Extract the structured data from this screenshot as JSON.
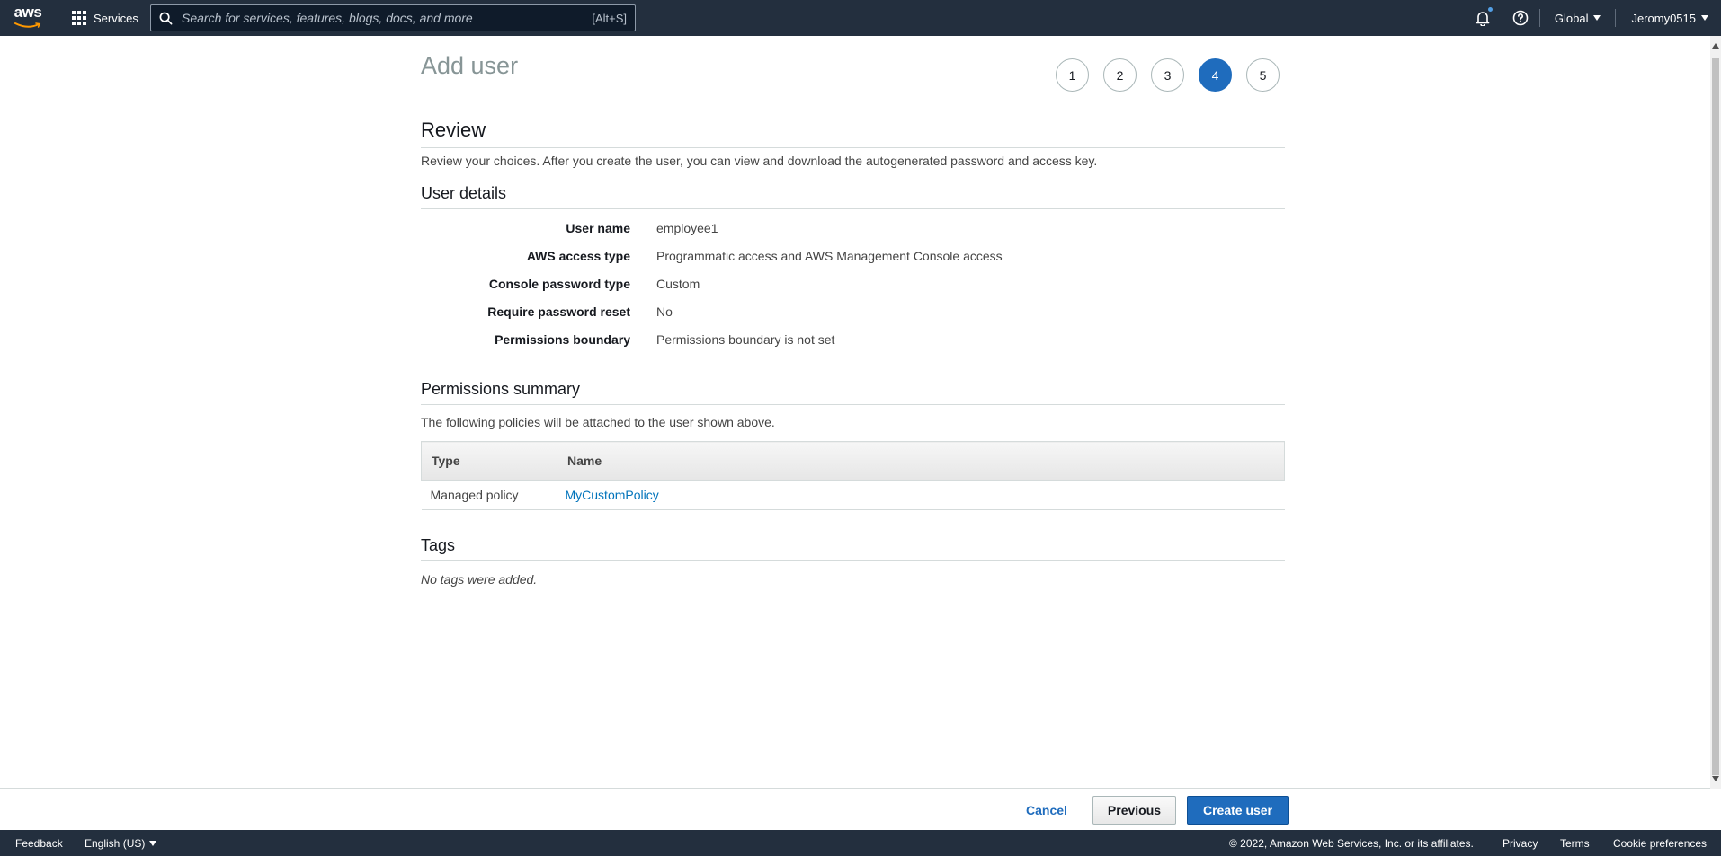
{
  "nav": {
    "logo": "aws",
    "services_label": "Services",
    "search_placeholder": "Search for services, features, blogs, docs, and more",
    "search_shortcut": "[Alt+S]",
    "region": "Global",
    "account": "Jeromy0515"
  },
  "page": {
    "title": "Add user",
    "steps": [
      "1",
      "2",
      "3",
      "4",
      "5"
    ],
    "active_step": "4"
  },
  "review": {
    "heading": "Review",
    "description": "Review your choices. After you create the user, you can view and download the autogenerated password and access key."
  },
  "user_details": {
    "heading": "User details",
    "rows": [
      {
        "key": "User name",
        "value": "employee1"
      },
      {
        "key": "AWS access type",
        "value": "Programmatic access and AWS Management Console access"
      },
      {
        "key": "Console password type",
        "value": "Custom"
      },
      {
        "key": "Require password reset",
        "value": "No"
      },
      {
        "key": "Permissions boundary",
        "value": "Permissions boundary is not set"
      }
    ]
  },
  "permissions": {
    "heading": "Permissions summary",
    "description": "The following policies will be attached to the user shown above.",
    "columns": [
      "Type",
      "Name"
    ],
    "rows": [
      {
        "type": "Managed policy",
        "name": "MyCustomPolicy"
      }
    ]
  },
  "tags": {
    "heading": "Tags",
    "empty_text": "No tags were added."
  },
  "actions": {
    "cancel": "Cancel",
    "previous": "Previous",
    "create": "Create user"
  },
  "footer": {
    "feedback": "Feedback",
    "language": "English (US)",
    "copyright": "© 2022, Amazon Web Services, Inc. or its affiliates.",
    "privacy": "Privacy",
    "terms": "Terms",
    "cookies": "Cookie preferences"
  },
  "colors": {
    "nav_bg": "#232f3e",
    "primary": "#1f6cbd",
    "link": "#0073bb"
  }
}
